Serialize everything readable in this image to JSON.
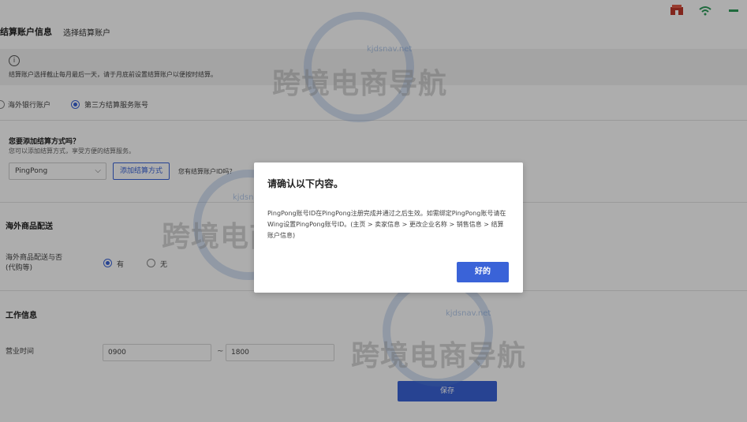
{
  "top_icons": [
    {
      "icon": "shop-icon",
      "color": "#c0392b"
    },
    {
      "icon": "wifi-icon",
      "color": "#2e9c5a"
    },
    {
      "icon": "minus-icon",
      "color": "#2e9c5a"
    }
  ],
  "header": {
    "title": "结算账户信息",
    "subtitle": "选择结算账户"
  },
  "banner": {
    "info_glyph": "i",
    "text": "结算账户选择截止每月最后一天，请于月底前设置结算账户以便按时结算。"
  },
  "account_type": {
    "options": [
      {
        "label": "海外银行账户",
        "selected": false
      },
      {
        "label": "第三方结算服务账号",
        "selected": true
      }
    ]
  },
  "add_method": {
    "title": "您要添加结算方式吗？",
    "desc": "您可以添加结算方式，享受方便的结算服务。",
    "select_value": "PingPong",
    "select_chevron": "⌵",
    "add_button": "添加结算方式",
    "ask_text": "您有结算账户ID吗？"
  },
  "overseas": {
    "section_title": "海外商品配送",
    "field_label_line1": "海外商品配送与否",
    "field_label_line2": "(代购等)",
    "options": [
      {
        "label": "有",
        "selected": true
      },
      {
        "label": "无",
        "selected": false
      }
    ]
  },
  "work": {
    "section_title": "工作信息",
    "hours_label": "营业时间",
    "start": "0900",
    "separator": "~",
    "end": "1800"
  },
  "save_button": "保存",
  "watermark": {
    "text": "跨境电商导航",
    "url": "kjdsnav.net"
  },
  "dialog": {
    "title": "请确认以下内容。",
    "body": "PingPong账号ID在PingPong注册完成并通过之后生效。如需绑定PingPong账号请在Wing设置PingPong账号ID。(主页 > 卖家信息 > 更改企业名称 > 销售信息 > 结算账户信息)",
    "ok_button": "好的"
  }
}
